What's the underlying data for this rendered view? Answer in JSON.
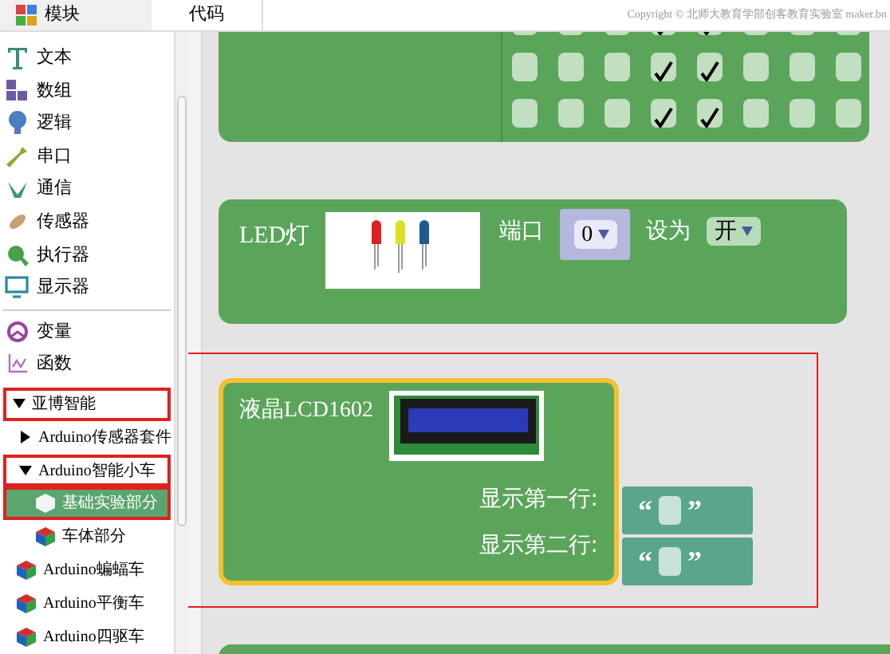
{
  "tabs": [
    {
      "label": "模块",
      "selected": true
    },
    {
      "label": "代码",
      "selected": false
    }
  ],
  "copyright": "Copyright © 北师大教育学部创客教育实验室 maker.bn",
  "categories": [
    {
      "label": "文本"
    },
    {
      "label": "数组"
    },
    {
      "label": "逻辑"
    },
    {
      "label": "串口"
    },
    {
      "label": "通信"
    },
    {
      "label": "传感器"
    },
    {
      "label": "执行器"
    },
    {
      "label": "显示器"
    }
  ],
  "categories_2": [
    {
      "label": "变量"
    },
    {
      "label": "函数"
    }
  ],
  "tree": [
    {
      "label": "亚博智能",
      "expanded": true,
      "highlighted": true,
      "children": [
        {
          "label": "Arduino传感器套件",
          "expanded": false,
          "highlighted": false
        },
        {
          "label": "Arduino智能小车",
          "expanded": true,
          "highlighted": true,
          "children": [
            {
              "label": "基础实验部分",
              "selected": true,
              "highlighted": true
            },
            {
              "label": "车体部分",
              "selected": false,
              "highlighted": false
            }
          ]
        },
        {
          "label": "Arduino蝙蝠车",
          "selected": false,
          "highlighted": false
        },
        {
          "label": "Arduino平衡车",
          "selected": false,
          "highlighted": false
        },
        {
          "label": "Arduino四驱车",
          "selected": false,
          "highlighted": false
        }
      ]
    }
  ],
  "matrix_block": {
    "rows": [
      [
        false,
        false,
        false,
        true,
        true,
        false,
        false,
        false
      ],
      [
        false,
        false,
        false,
        true,
        true,
        false,
        false,
        false
      ],
      [
        false,
        false,
        false,
        true,
        true,
        false,
        false,
        false
      ]
    ]
  },
  "led_block": {
    "title": "LED灯",
    "port_label": "端口",
    "port_value": "0",
    "set_label": "设为",
    "state_value": "开"
  },
  "lcd_block": {
    "title": "液晶LCD1602",
    "highlighted": true,
    "inputs": [
      {
        "label": "显示第一行:",
        "open": "“",
        "close": "”"
      },
      {
        "label": "显示第二行:",
        "open": "“",
        "close": "”"
      }
    ]
  }
}
